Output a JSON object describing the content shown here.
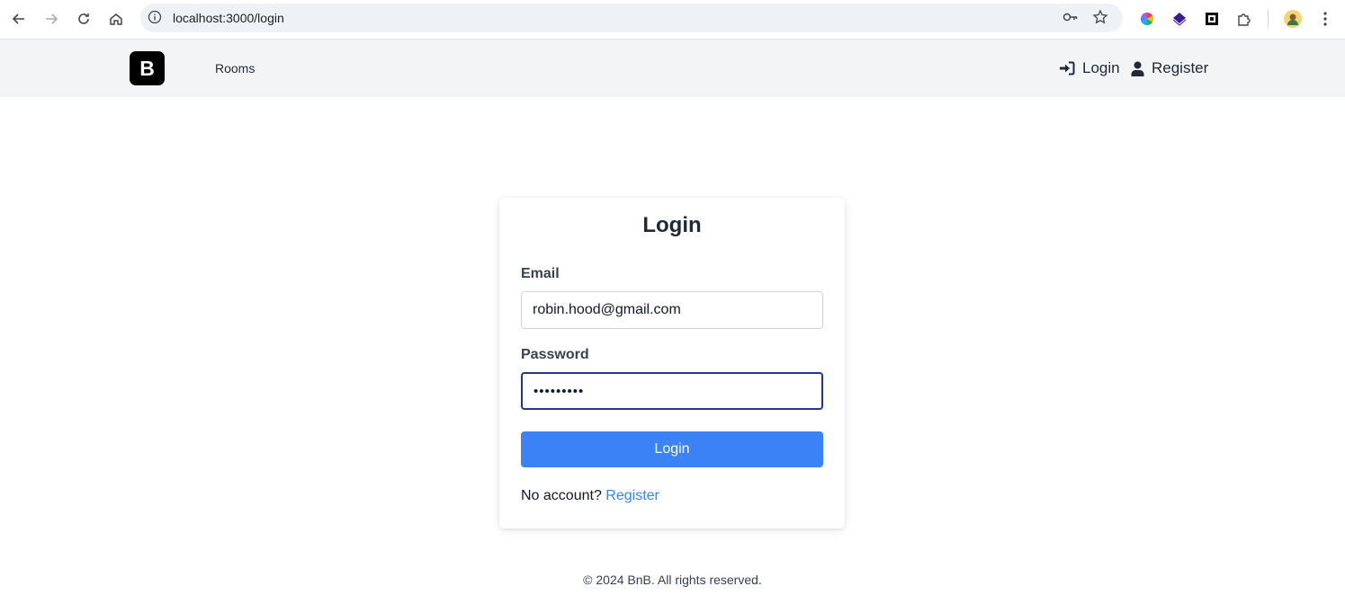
{
  "browser": {
    "url": "localhost:3000/login"
  },
  "nav": {
    "logo_letter": "B",
    "rooms_label": "Rooms",
    "login_label": "Login",
    "register_label": "Register"
  },
  "login_form": {
    "title": "Login",
    "email_label": "Email",
    "email_value": "robin.hood@gmail.com",
    "password_label": "Password",
    "password_value": "•••••••••",
    "submit_label": "Login",
    "no_account_text": "No account?",
    "register_link": "Register"
  },
  "footer": {
    "text": "© 2024 BnB. All rights reserved."
  },
  "colors": {
    "accent": "#3b82f6",
    "nav_bg": "#f3f4f6",
    "focus_border": "#1e3a8a"
  }
}
